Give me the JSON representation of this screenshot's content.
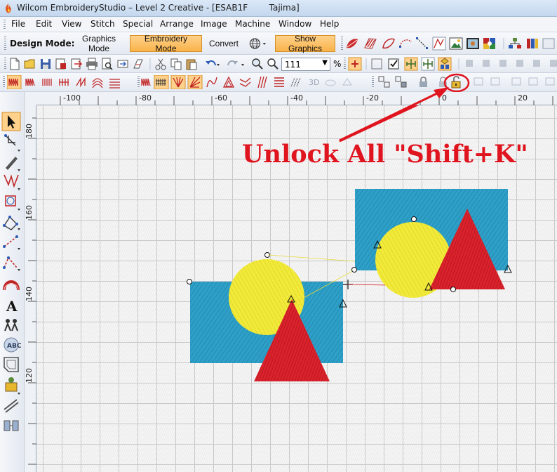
{
  "window": {
    "title": "Wilcom EmbroideryStudio – Level 2 Creative - [ESAB1F        Tajima]"
  },
  "menu": [
    "File",
    "Edit",
    "View",
    "Stitch",
    "Special",
    "Arrange",
    "Image",
    "Machine",
    "Window",
    "Help"
  ],
  "toolbar": {
    "design_mode_label": "Design Mode:",
    "graphics_mode": "Graphics Mode",
    "embroidery_mode": "Embroidery Mode",
    "convert": "Convert",
    "show_graphics": "Show Graphics",
    "zoom_value": "111",
    "zoom_unit": "%"
  },
  "ruler": {
    "horizontal": [
      "-100",
      "-80",
      "-60",
      "-40",
      "-20",
      "0",
      "20"
    ],
    "vertical": [
      "180",
      "160",
      "140",
      "120"
    ]
  },
  "annotation": {
    "text": "Unlock All \"Shift+K\"",
    "color": "#e0141e"
  },
  "colors": {
    "fill_blue": "#2ea0c8",
    "fill_yellow": "#f2ea3a",
    "fill_red": "#d9222c",
    "active_button": "#f9b34a"
  },
  "icons": {
    "app": "wilcom-flame-icon",
    "unlock_all": "unlock-all-icon"
  }
}
